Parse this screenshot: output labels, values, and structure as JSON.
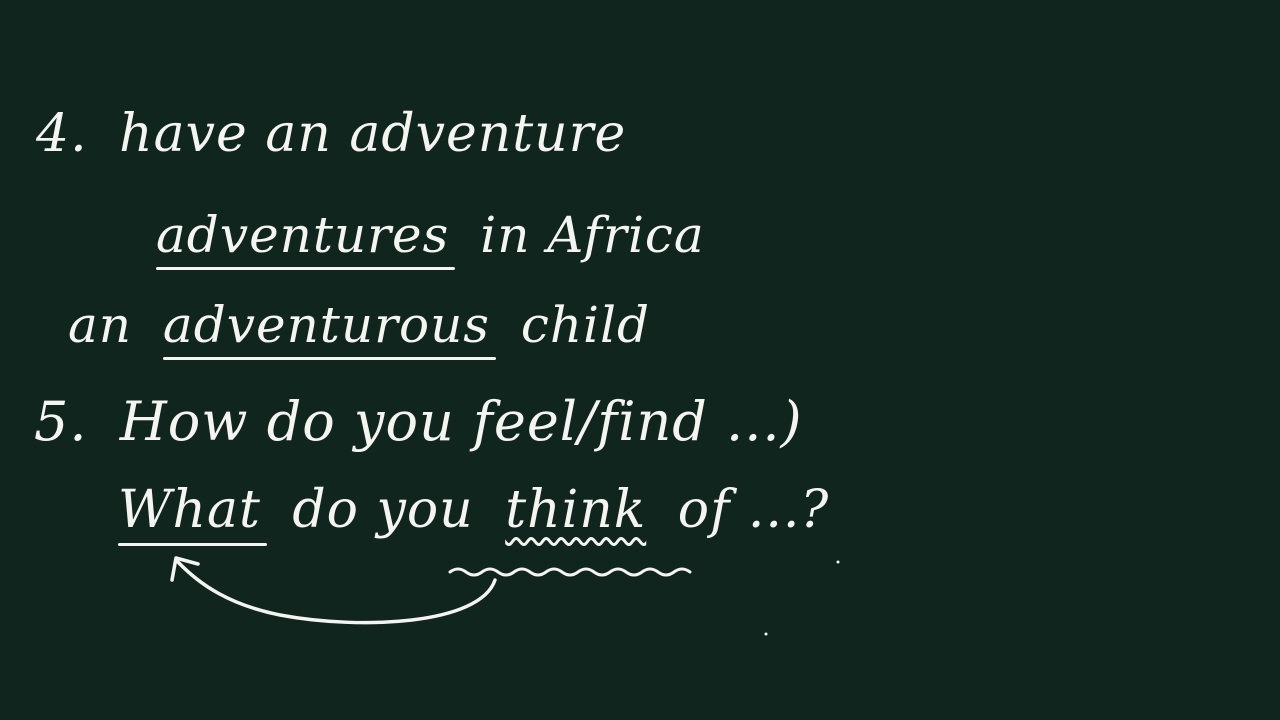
{
  "board": {
    "background": "#11251f",
    "ink": "#f4f4f0",
    "lines": {
      "l1_num": "4.",
      "l1_text": "have an adventure",
      "l2_word": "adventures",
      "l2_rest": "in Africa",
      "l3_pre": "an",
      "l3_word": "adventurous",
      "l3_post": "child",
      "l4_num": "5.",
      "l4_text": "How do you feel/find ...)",
      "l5_word": "What",
      "l5_mid": "do you",
      "l5_word2": "think",
      "l5_post": "of ...?"
    }
  }
}
